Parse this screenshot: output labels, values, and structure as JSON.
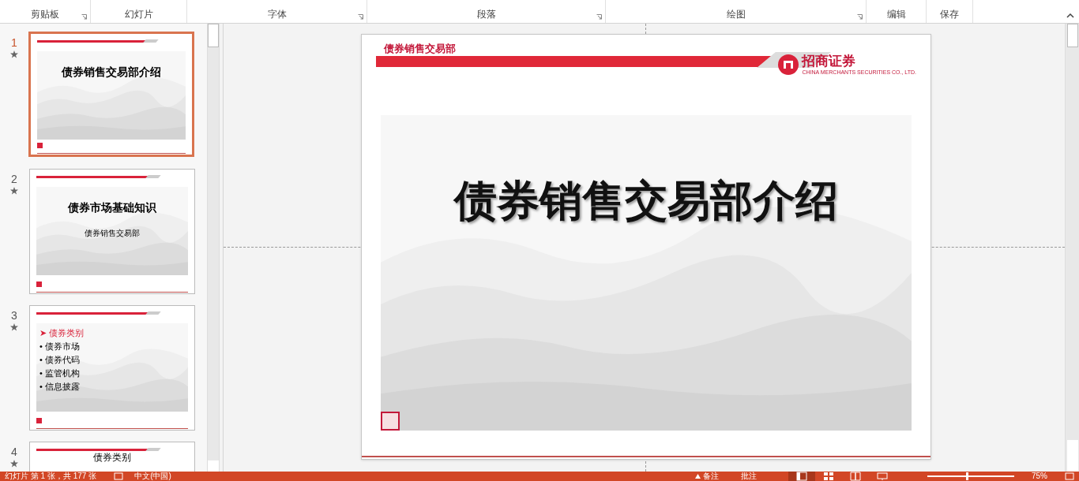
{
  "ribbon": {
    "groups": [
      {
        "label": "剪贴板",
        "launcher": true
      },
      {
        "label": "幻灯片",
        "launcher": false
      },
      {
        "label": "字体",
        "launcher": true
      },
      {
        "label": "段落",
        "launcher": true
      },
      {
        "label": "绘图",
        "launcher": true
      },
      {
        "label": "编辑",
        "launcher": false
      },
      {
        "label": "保存",
        "launcher": false
      }
    ]
  },
  "thumbnails": [
    {
      "number": "1",
      "selected": true,
      "kind": "title",
      "title": "债券销售交易部介绍"
    },
    {
      "number": "2",
      "selected": false,
      "kind": "title",
      "title": "债券市场基础知识",
      "subtitle": "债券销售交易部"
    },
    {
      "number": "3",
      "selected": false,
      "kind": "bullets",
      "bullets": [
        {
          "marker": "➤",
          "text": "债券类别",
          "highlighted": true
        },
        {
          "marker": "•",
          "text": "债券市场",
          "highlighted": false
        },
        {
          "marker": "•",
          "text": "债券代码",
          "highlighted": false
        },
        {
          "marker": "•",
          "text": "监管机构",
          "highlighted": false
        },
        {
          "marker": "•",
          "text": "信息披露",
          "highlighted": false
        }
      ]
    },
    {
      "number": "4",
      "selected": false,
      "kind": "header",
      "title": "债券类别"
    }
  ],
  "slide": {
    "header": "债券销售交易部",
    "logo_name": "招商证券",
    "logo_subtitle": "CHINA MERCHANTS SECURITIES CO., LTD.",
    "title": "债券销售交易部介绍"
  },
  "status_bar": {
    "slide_info": "幻灯片 第 1 张，共 177 张",
    "language": "中文(中国)",
    "notes": "备注",
    "comments": "批注",
    "views": [
      {
        "kind": "normal",
        "selected": true
      },
      {
        "kind": "sorter",
        "selected": false
      },
      {
        "kind": "reading",
        "selected": false
      },
      {
        "kind": "show",
        "selected": false
      }
    ],
    "zoom": {
      "level": 0.45,
      "reading": "75%"
    }
  }
}
